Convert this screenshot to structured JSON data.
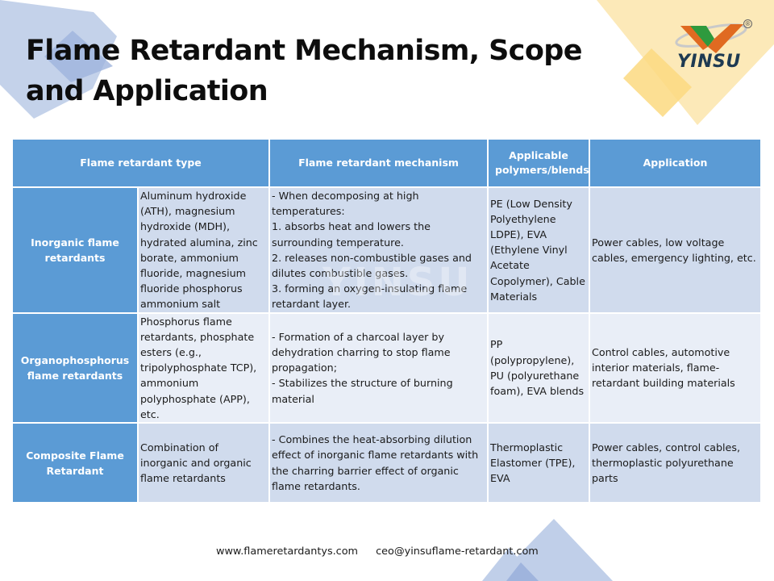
{
  "slide": {
    "title": "Flame Retardant Mechanism, Scope and Application",
    "colors": {
      "header_blue": "#5b9bd5",
      "row_light": "#d0dbed",
      "row_lighter": "#e9eef7",
      "accent_yellow": "#fbd980",
      "accent_blue_shape": "#b4c7e7"
    }
  },
  "logo": {
    "name": "YINSU",
    "registered_mark": "®",
    "icon": "yinsu-v-logo-icon"
  },
  "watermark": "YINSU",
  "table": {
    "headers": [
      "Flame retardant type",
      "Flame retardant mechanism",
      "Applicable polymers/blends",
      "Application"
    ],
    "rows": [
      {
        "type": "Inorganic flame retardants",
        "examples": "Aluminum hydroxide (ATH), magnesium hydroxide (MDH), hydrated alumina, zinc borate, ammonium fluoride, magnesium fluoride phosphorus ammonium salt",
        "mechanism": "- When decomposing at high temperatures:\n1. absorbs heat and lowers the surrounding temperature.\n2. releases non-combustible gases and dilutes combustible gases.\n3. forming an oxygen-insulating flame retardant layer.",
        "polymers": "PE (Low Density Polyethylene LDPE), EVA (Ethylene Vinyl Acetate Copolymer), Cable Materials",
        "application": "Power cables, low voltage cables, emergency lighting, etc."
      },
      {
        "type": "Organophosphorus flame retardants",
        "examples": "Phosphorus flame retardants, phosphate esters (e.g., tripolyphosphate TCP), ammonium polyphosphate (APP), etc.",
        "mechanism": "- Formation of a charcoal layer by dehydration charring to stop flame propagation;\n- Stabilizes the structure of burning material",
        "polymers": "PP (polypropylene), PU (polyurethane foam), EVA blends",
        "application": "Control cables, automotive interior materials, flame-retardant building materials"
      },
      {
        "type": "Composite Flame Retardant",
        "examples": "Combination of inorganic and organic flame retardants",
        "mechanism": "- Combines the heat-absorbing dilution effect of inorganic flame retardants with the charring barrier effect of organic flame retardants.",
        "polymers": "Thermoplastic Elastomer (TPE), EVA",
        "application": "Power cables, control cables, thermoplastic polyurethane parts"
      }
    ]
  },
  "footer": {
    "website": "www.flameretardantys.com",
    "email": "ceo@yinsuflame-retardant.com"
  }
}
